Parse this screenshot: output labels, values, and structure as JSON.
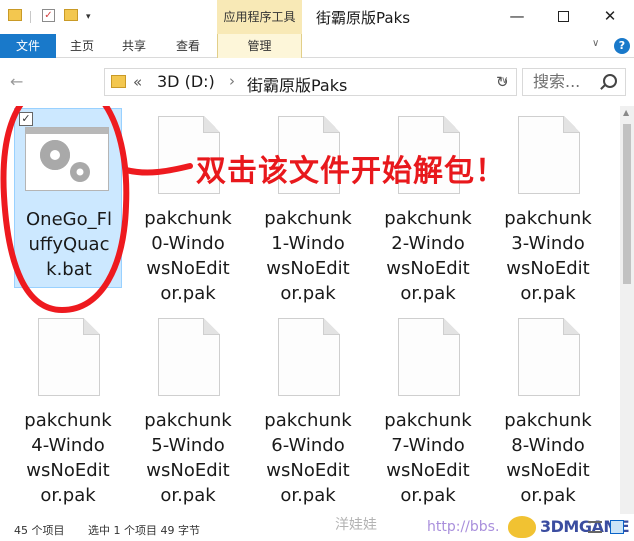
{
  "titlebar": {
    "context_tab_title": "应用程序工具",
    "window_title": "街霸原版Paks",
    "minimize": "—",
    "close": "✕"
  },
  "ribbon": {
    "file": "文件",
    "home": "主页",
    "share": "共享",
    "view": "查看",
    "manage": "管理",
    "help": "?"
  },
  "address": {
    "overflow": "«",
    "segment1": "3D (D:)",
    "separator": "›",
    "segment2": "街霸原版Paks",
    "dropdown": "∨",
    "refresh": "↻"
  },
  "search": {
    "placeholder": "搜索..."
  },
  "files": [
    {
      "name": "OneGo_FluffyQuack.bat",
      "display": "OneGo_Fl uffyQuac k.bat",
      "type": "bat",
      "selected": true
    },
    {
      "name": "pakchunk0-WindowsNoEditor.pak",
      "display": "pakchunk 0-Windo wsNoEdit or.pak",
      "type": "pak"
    },
    {
      "name": "pakchunk1-WindowsNoEditor.pak",
      "display": "pakchunk 1-Windo wsNoEdit or.pak",
      "type": "pak"
    },
    {
      "name": "pakchunk2-WindowsNoEditor.pak",
      "display": "pakchunk 2-Windo wsNoEdit or.pak",
      "type": "pak"
    },
    {
      "name": "pakchunk3-WindowsNoEditor.pak",
      "display": "pakchunk 3-Windo wsNoEdit or.pak",
      "type": "pak"
    },
    {
      "name": "pakchunk4-WindowsNoEditor.pak",
      "display": "pakchunk 4-Windo wsNoEdit or.pak",
      "type": "pak"
    },
    {
      "name": "pakchunk5-WindowsNoEditor.pak",
      "display": "pakchunk 5-Windo wsNoEdit or.pak",
      "type": "pak"
    },
    {
      "name": "pakchunk6-WindowsNoEditor.pak",
      "display": "pakchunk 6-Windo wsNoEdit or.pak",
      "type": "pak"
    },
    {
      "name": "pakchunk7-WindowsNoEditor.pak",
      "display": "pakchunk 7-Windo wsNoEdit or.pak",
      "type": "pak"
    },
    {
      "name": "pakchunk8-WindowsNoEditor.pak",
      "display": "pakchunk 8-Windo wsNoEdit or.pak",
      "type": "pak"
    }
  ],
  "annotation": {
    "text": "双击该文件开始解包！",
    "color": "#e8181c"
  },
  "status": {
    "item_count": "45 个项目",
    "selection": "选中 1 个项目  49 字节"
  },
  "watermark": {
    "name": "洋娃娃",
    "url": "http://bbs.",
    "logo": "3DMGAME"
  },
  "colors": {
    "accent": "#1979ca",
    "context_tab": "#f8e9b6",
    "selection": "#cce8ff"
  }
}
